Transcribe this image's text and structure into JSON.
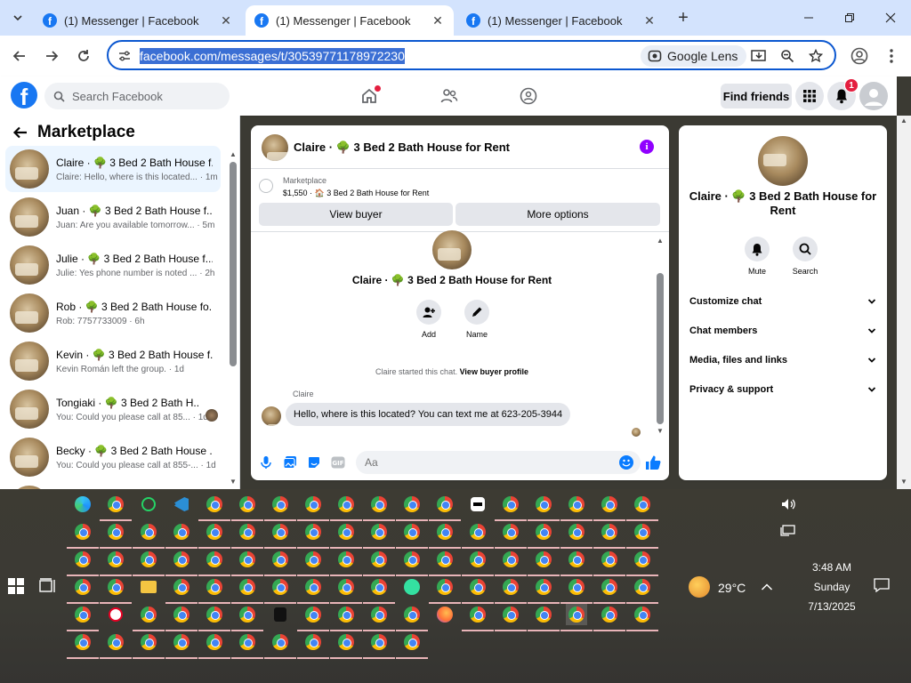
{
  "browser": {
    "tabs": [
      {
        "title": "(1) Messenger | Facebook",
        "active": false
      },
      {
        "title": "(1) Messenger | Facebook",
        "active": true
      },
      {
        "title": "(1) Messenger | Facebook",
        "active": false
      }
    ],
    "url": "facebook.com/messages/t/30539771178972230",
    "lens_label": "Google Lens",
    "close_glyph": "✕",
    "new_tab_glyph": "+"
  },
  "facebook": {
    "search_placeholder": "Search Facebook",
    "find_friends": "Find friends",
    "notification_count": "1"
  },
  "chat_list": {
    "title": "Marketplace",
    "conversations": [
      {
        "name": "Claire · 🌳 3 Bed 2 Bath House f...",
        "preview": "Claire: Hello, where is this located... · 1m",
        "selected": true
      },
      {
        "name": "Juan · 🌳 3 Bed 2 Bath House f...",
        "preview": "Juan: Are you available tomorrow... · 5m"
      },
      {
        "name": "Julie · 🌳 3 Bed 2 Bath House f...",
        "preview": "Julie: Yes phone number is noted ... · 2h"
      },
      {
        "name": "Rob · 🌳 3 Bed 2 Bath House fo...",
        "preview": "Rob: 7757733009 · 6h"
      },
      {
        "name": "Kevin · 🌳 3 Bed 2 Bath House f...",
        "preview": "Kevin Román left the group. · 1d"
      },
      {
        "name": "Tongiaki · 🌳 3 Bed 2 Bath H...",
        "preview": "You: Could you please call at 85... · 1d"
      },
      {
        "name": "Becky · 🌳 3 Bed 2 Bath House ...",
        "preview": "You: Could you please call at 855-... · 1d"
      }
    ]
  },
  "chat": {
    "header_title": "Claire · 🌳 3 Bed 2 Bath House for Rent",
    "marketplace_label": "Marketplace",
    "listing_line": "$1,550 · 🏠 3 Bed 2 Bath House for Rent",
    "view_buyer": "View buyer",
    "more_options": "More options",
    "big_title": "Claire · 🌳 3 Bed 2 Bath House for Rent",
    "actions": [
      {
        "label": "Add",
        "icon": "add-person-icon"
      },
      {
        "label": "Name",
        "icon": "pencil-icon"
      }
    ],
    "started_text": "Claire started this chat.",
    "view_buyer_profile": "View buyer profile",
    "sender": "Claire",
    "message": "Hello, where is this located? You can text me at 623-205-3944",
    "input_placeholder": "Aa"
  },
  "details": {
    "name": "Claire · 🌳 3 Bed 2 Bath House for Rent",
    "actions": [
      {
        "label": "Mute",
        "icon": "bell-icon"
      },
      {
        "label": "Search",
        "icon": "search-icon"
      }
    ],
    "sections": [
      "Customize chat",
      "Chat members",
      "Media, files and links",
      "Privacy & support"
    ]
  },
  "taskbar": {
    "temperature": "29°C",
    "time": "3:48 AM",
    "day": "Sunday",
    "date": "7/13/2025"
  },
  "colors": {
    "fb_blue": "#1877f2",
    "messenger_accent": "#0a7cff",
    "info_purple": "#9000ff",
    "notification_red": "#e41e3f"
  }
}
